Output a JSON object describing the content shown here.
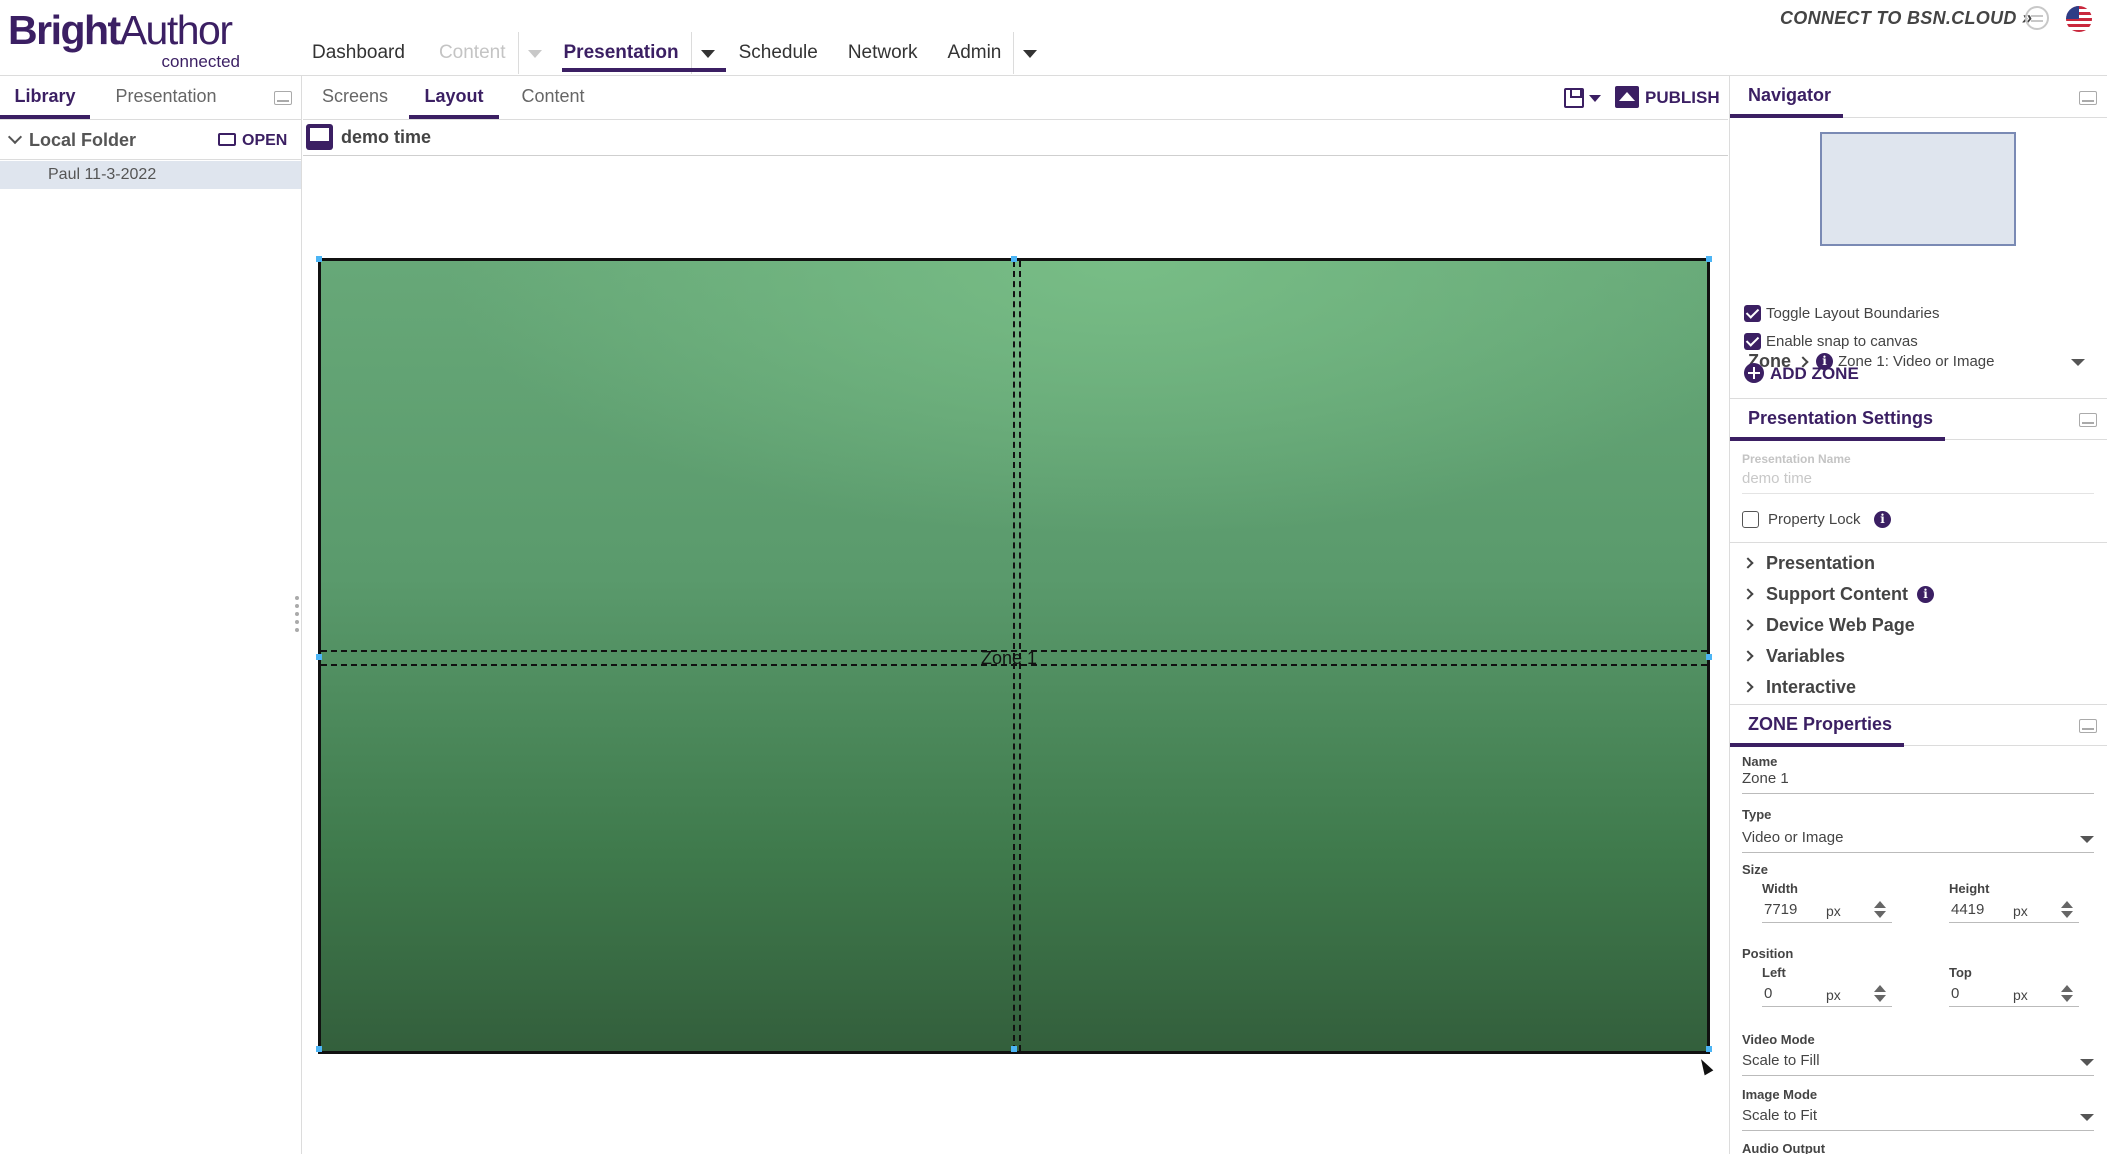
{
  "header": {
    "logo_bright": "Bright",
    "logo_author": "Author",
    "logo_sub": "connected",
    "nav": {
      "dashboard": "Dashboard",
      "content": "Content",
      "presentation": "Presentation",
      "schedule": "Schedule",
      "network": "Network",
      "admin": "Admin"
    },
    "connect_label": "CONNECT TO BSN.CLOUD »"
  },
  "left_panel": {
    "tabs": [
      "Library",
      "Presentation"
    ],
    "folder_label": "Local Folder",
    "open_label": "OPEN",
    "items": [
      "Paul 11-3-2022"
    ]
  },
  "center": {
    "tabs": [
      "Screens",
      "Layout",
      "Content"
    ],
    "publish_label": "PUBLISH",
    "presentation_name": "demo time",
    "zone_label": "Zone 1"
  },
  "navigator": {
    "title": "Navigator",
    "zone_prefix": "Zone",
    "zone_selected": "Zone 1: Video or Image",
    "toggle_boundaries": "Toggle Layout Boundaries",
    "snap_canvas": "Enable snap to canvas",
    "add_zone": "ADD ZONE"
  },
  "presentation_settings": {
    "title": "Presentation Settings",
    "name_label": "Presentation Name",
    "name_value": "demo time",
    "property_lock": "Property Lock",
    "sections": [
      "Presentation",
      "Support Content",
      "Device Web Page",
      "Variables",
      "Interactive"
    ]
  },
  "zone_properties": {
    "title": "ZONE Properties",
    "name_label": "Name",
    "name_value": "Zone 1",
    "type_label": "Type",
    "type_value": "Video or Image",
    "size_label": "Size",
    "width_label": "Width",
    "width_value": "7719",
    "height_label": "Height",
    "height_value": "4419",
    "unit": "px",
    "position_label": "Position",
    "left_label": "Left",
    "left_value": "0",
    "top_label": "Top",
    "top_value": "0",
    "video_mode_label": "Video Mode",
    "video_mode_value": "Scale to Fill",
    "image_mode_label": "Image Mode",
    "image_mode_value": "Scale to Fit",
    "audio_output_label": "Audio Output"
  },
  "colors": {
    "brand": "#3b1f63",
    "selection": "#dfe5ee",
    "handle": "#4cb5f5"
  }
}
